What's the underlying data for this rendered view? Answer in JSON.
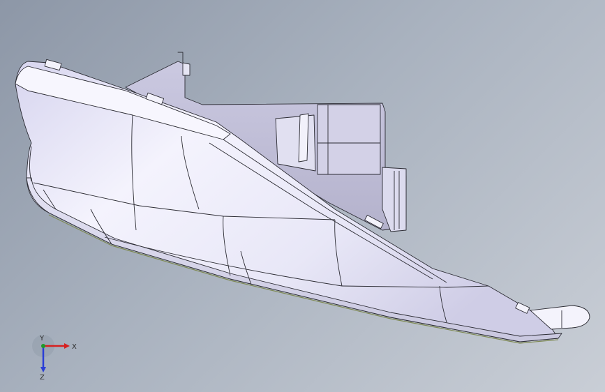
{
  "viewport": {
    "background_top": "#8d97a7",
    "background_bottom": "#c9ced6",
    "model_face_color": "#e9e8f6",
    "edge_color": "#2b2b33"
  },
  "triad": {
    "x_label": "X",
    "y_label": "Y",
    "z_label": "Z",
    "x_color": "#d62020",
    "y_color": "#1f9a2a",
    "z_color": "#2a3ed6"
  }
}
